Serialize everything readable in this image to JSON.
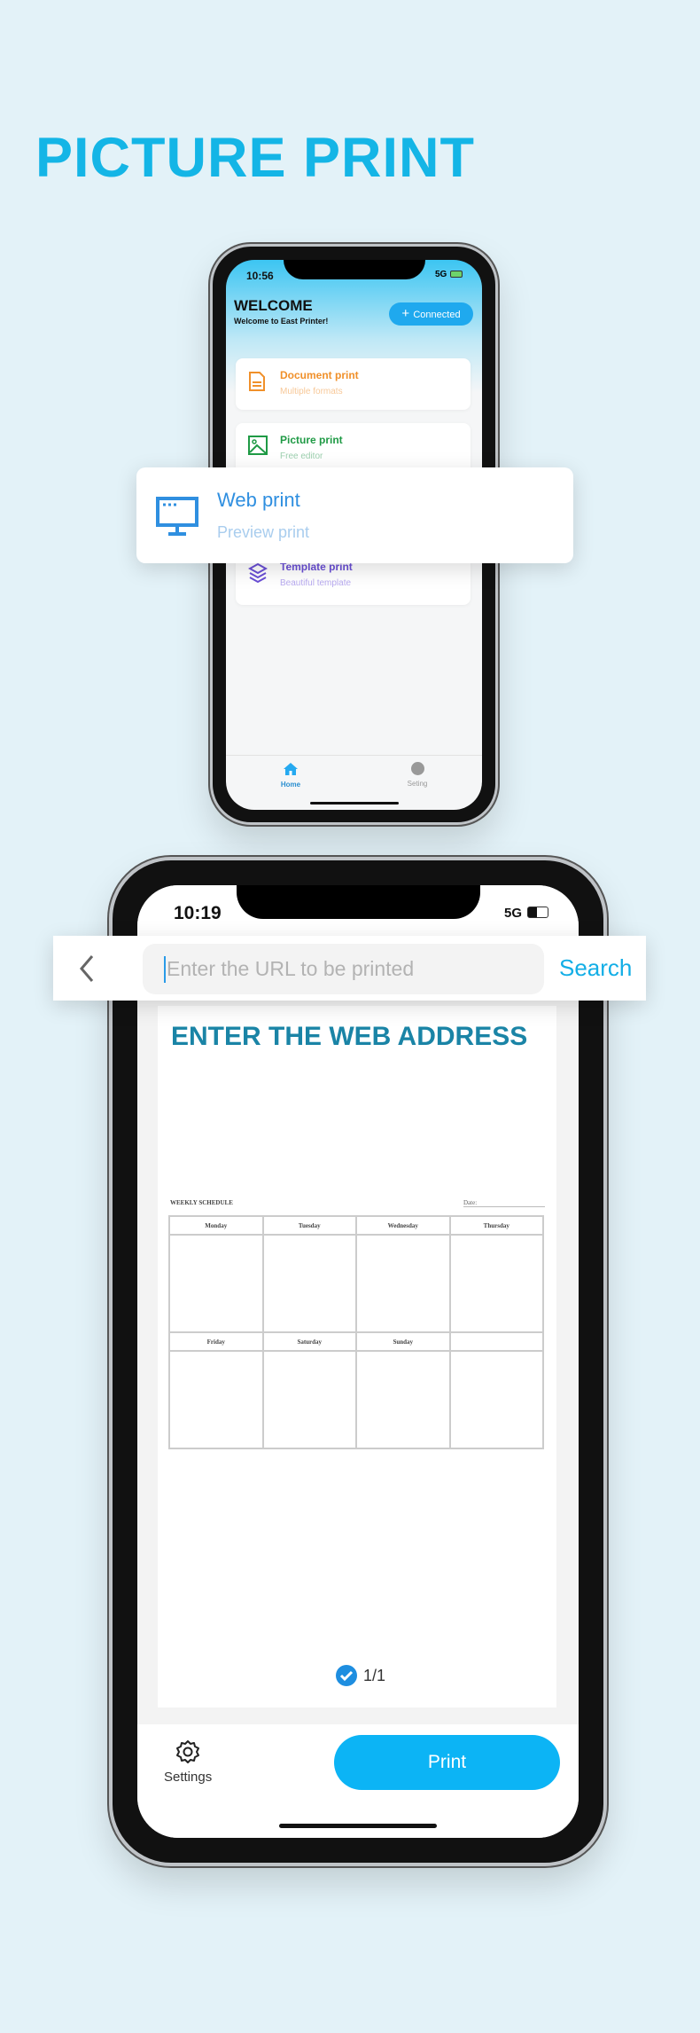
{
  "title": "PICTURE PRINT",
  "phone1": {
    "status": {
      "time": "10:56",
      "network": "5G"
    },
    "header": {
      "title": "WELCOME",
      "subtitle": "Welcome to East Printer!",
      "connected_label": "Connected"
    },
    "cards": [
      {
        "title": "Document print",
        "subtitle": "Multiple formats",
        "color": "#f0902a"
      },
      {
        "title": "Picture print",
        "subtitle": "Free editor",
        "color": "#1f9a45"
      },
      {
        "title": "Template print",
        "subtitle": "Beautiful template",
        "color": "#6a4fd6"
      }
    ],
    "web_print": {
      "title": "Web print",
      "subtitle": "Preview print",
      "color": "#2f8fe0"
    },
    "tabs": [
      {
        "label": "Home",
        "active": true
      },
      {
        "label": "Seting",
        "active": false
      }
    ]
  },
  "phone2": {
    "status": {
      "time": "10:19",
      "network": "5G"
    },
    "search": {
      "placeholder": "Enter the URL to be printed",
      "button": "Search"
    },
    "heading": "ENTER THE WEB ADDRESS",
    "schedule": {
      "title": "WEEKLY SCHEDULE",
      "date_label": "Date:",
      "row1": [
        "Monday",
        "Tuesday",
        "Wednesday",
        "Thursday"
      ],
      "row2": [
        "Friday",
        "Saturday",
        "Sunday",
        ""
      ]
    },
    "page_indicator": "1/1",
    "settings_label": "Settings",
    "print_label": "Print",
    "accent": "#0cb4f5"
  }
}
